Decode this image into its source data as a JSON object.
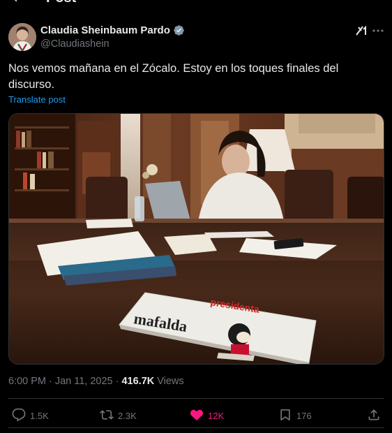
{
  "header": {
    "title": "Post"
  },
  "author": {
    "display_name": "Claudia Sheinbaum Pardo",
    "handle": "@Claudiashein",
    "verified": true
  },
  "post": {
    "text": "Nos vemos mañana en el Zócalo. Estoy en los toques finales del discurso.",
    "translate_label": "Translate post"
  },
  "media": {
    "book_title": "mafalda",
    "book_subtitle": "presidenta"
  },
  "meta": {
    "time": "6:00 PM",
    "separator": "·",
    "date": "Jan 11, 2025",
    "views_count": "416.7K",
    "views_label": "Views"
  },
  "actions": {
    "replies": "1.5K",
    "reposts": "2.3K",
    "likes": "12K",
    "bookmarks": "176"
  },
  "colors": {
    "background": "#000000",
    "text_primary": "#e7e9ea",
    "text_secondary": "#71767b",
    "link": "#1d9bf0",
    "like": "#f91880",
    "divider": "#2f3336"
  }
}
